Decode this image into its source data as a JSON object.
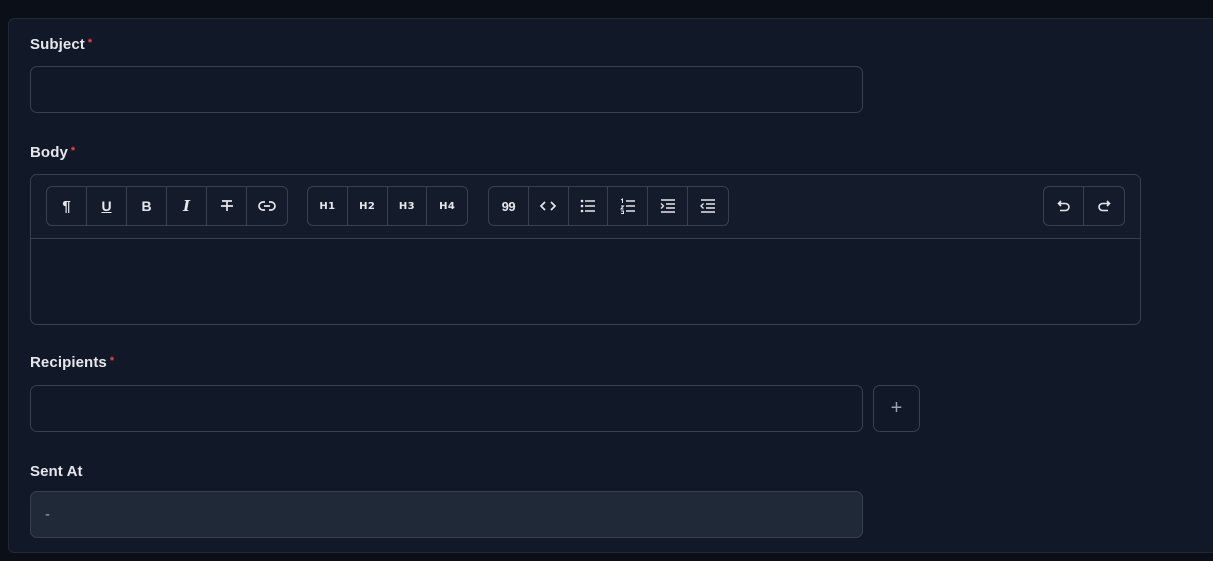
{
  "form": {
    "subject": {
      "label": "Subject",
      "required_mark": "*",
      "value": ""
    },
    "body": {
      "label": "Body",
      "required_mark": "*",
      "toolbar": {
        "format_group": [
          {
            "name": "paragraph-icon",
            "glyph": "¶"
          },
          {
            "name": "underline-icon",
            "glyph": "U"
          },
          {
            "name": "bold-icon",
            "glyph": "B"
          },
          {
            "name": "italic-icon",
            "glyph": "I"
          },
          {
            "name": "strikethrough-icon",
            "glyph": "T"
          },
          {
            "name": "link-icon",
            "glyph": "link"
          }
        ],
        "heading_group": [
          "H1",
          "H2",
          "H3",
          "H4"
        ],
        "block_group": [
          {
            "name": "blockquote-icon",
            "glyph": "99"
          },
          {
            "name": "code-icon",
            "glyph": "<>"
          },
          {
            "name": "bullet-list-icon"
          },
          {
            "name": "ordered-list-icon"
          },
          {
            "name": "indent-icon"
          },
          {
            "name": "outdent-icon"
          }
        ],
        "history_group": [
          {
            "name": "undo-icon"
          },
          {
            "name": "redo-icon"
          }
        ]
      }
    },
    "recipients": {
      "label": "Recipients",
      "required_mark": "*",
      "value": "",
      "add_symbol": "+"
    },
    "sent_at": {
      "label": "Sent At",
      "value": "-"
    }
  },
  "colors": {
    "background": "#111827",
    "border": "#374151",
    "required": "#ef4444",
    "text": "#e5e7eb"
  }
}
